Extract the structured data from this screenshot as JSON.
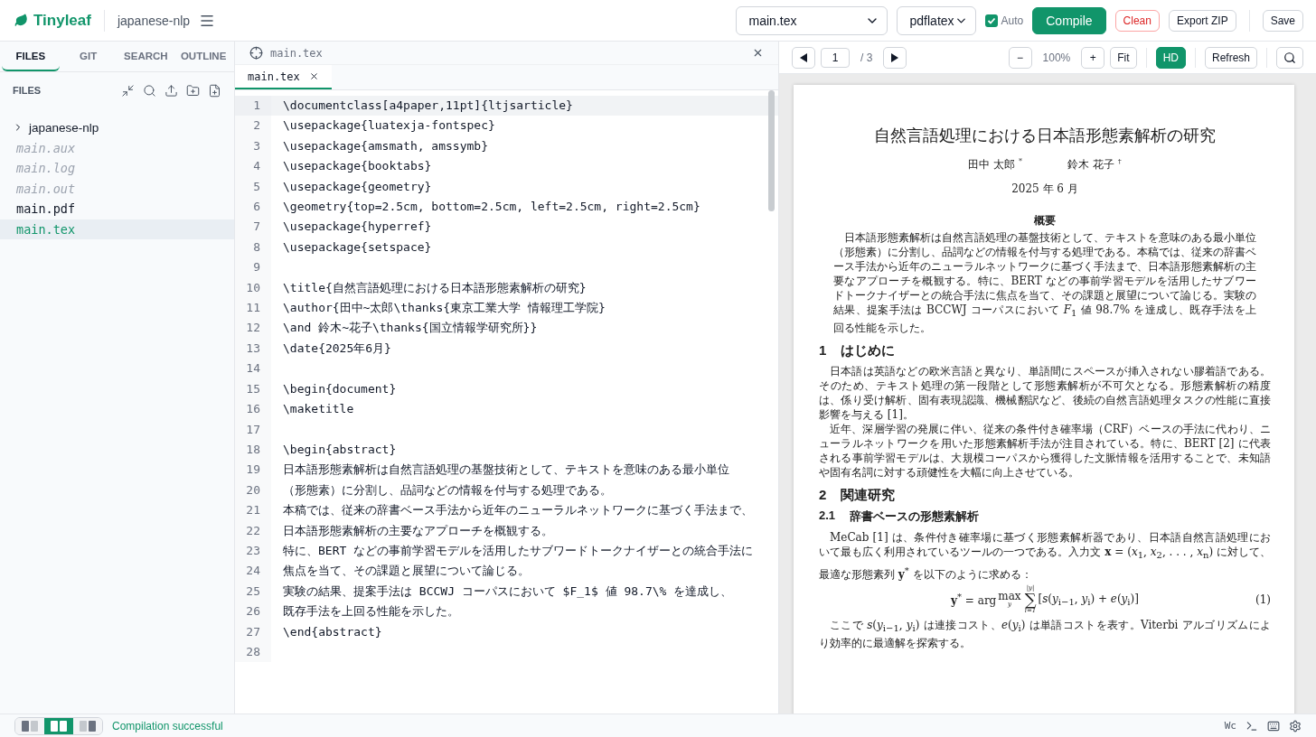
{
  "topbar": {
    "app_name": "Tinyleaf",
    "project": "japanese-nlp",
    "file_select": "main.tex",
    "engine_select": "pdflatex",
    "auto": {
      "label": "Auto",
      "checked": true
    },
    "buttons": [
      {
        "label": "Compile",
        "kind": "primary"
      },
      {
        "label": "Clean",
        "kind": "danger"
      },
      {
        "label": "Export ZIP",
        "kind": "default"
      }
    ],
    "save": "Save"
  },
  "sidebar": {
    "tabs": [
      {
        "label": "FILES",
        "selected": true
      },
      {
        "label": "GIT",
        "selected": false
      },
      {
        "label": "SEARCH",
        "selected": false
      },
      {
        "label": "OUTLINE",
        "selected": false
      }
    ],
    "header": "FILES",
    "tree": [
      {
        "kind": "folder",
        "name": "japanese-nlp",
        "expanded": false,
        "selected": false
      },
      {
        "kind": "file",
        "name": "main.aux",
        "generated": true,
        "selected": false
      },
      {
        "kind": "file",
        "name": "main.log",
        "generated": true,
        "selected": false
      },
      {
        "kind": "file",
        "name": "main.out",
        "generated": true,
        "selected": false
      },
      {
        "kind": "file",
        "name": "main.pdf",
        "generated": false,
        "selected": false
      },
      {
        "kind": "file",
        "name": "main.tex",
        "generated": false,
        "selected": true
      }
    ]
  },
  "editor": {
    "path": "main.tex",
    "tabs": [
      {
        "label": "main.tex",
        "selected": true
      }
    ],
    "lines": [
      {
        "number": "1",
        "text": "\\documentclass[a4paper,11pt]{ltjsarticle}",
        "active": true
      },
      {
        "number": "2",
        "text": "\\usepackage{luatexja-fontspec}",
        "active": false
      },
      {
        "number": "3",
        "text": "\\usepackage{amsmath, amssymb}",
        "active": false
      },
      {
        "number": "4",
        "text": "\\usepackage{booktabs}",
        "active": false
      },
      {
        "number": "5",
        "text": "\\usepackage{geometry}",
        "active": false
      },
      {
        "number": "6",
        "text": "\\geometry{top=2.5cm, bottom=2.5cm, left=2.5cm, right=2.5cm}",
        "active": false
      },
      {
        "number": "7",
        "text": "\\usepackage{hyperref}",
        "active": false
      },
      {
        "number": "8",
        "text": "\\usepackage{setspace}",
        "active": false
      },
      {
        "number": "9",
        "active": false
      },
      {
        "number": "10",
        "text": "\\title{自然言語処理における日本語形態素解析の研究}",
        "active": false
      },
      {
        "number": "11",
        "text": "\\author{田中~太郎\\thanks{東京工業大学 情報理工学院}",
        "active": false
      },
      {
        "number": "12",
        "text": "\\and 鈴木~花子\\thanks{国立情報学研究所}}",
        "active": false
      },
      {
        "number": "13",
        "text": "\\date{2025年6月}",
        "active": false
      },
      {
        "number": "14",
        "active": false
      },
      {
        "number": "15",
        "text": "\\begin{document}",
        "active": false
      },
      {
        "number": "16",
        "text": "\\maketitle",
        "active": false
      },
      {
        "number": "17",
        "active": false
      },
      {
        "number": "18",
        "text": "\\begin{abstract}",
        "active": false
      },
      {
        "number": "19",
        "text": "日本語形態素解析は自然言語処理の基盤技術として、テキストを意味のある最小単位",
        "active": false
      },
      {
        "number": "20",
        "text": "（形態素）に分割し、品詞などの情報を付与する処理である。",
        "active": false
      },
      {
        "number": "21",
        "text": "本稿では、従来の辞書ベース手法から近年のニューラルネットワークに基づく手法まで、",
        "active": false
      },
      {
        "number": "22",
        "text": "日本語形態素解析の主要なアプローチを概観する。",
        "active": false
      },
      {
        "number": "23",
        "text": "特に、BERT などの事前学習モデルを活用したサブワードトークナイザーとの統合手法に",
        "active": false
      },
      {
        "number": "24",
        "text": "焦点を当て、その課題と展望について論じる。",
        "active": false
      },
      {
        "number": "25",
        "text": "実験の結果、提案手法は BCCWJ コーパスにおいて $F_1$ 値 98.7\\% を達成し、",
        "active": false
      },
      {
        "number": "26",
        "text": "既存手法を上回る性能を示した。",
        "active": false
      },
      {
        "number": "27",
        "text": "\\end{abstract}",
        "active": false
      },
      {
        "number": "28",
        "active": false
      }
    ]
  },
  "pdf": {
    "page": "1",
    "total": "/ 3",
    "zoom_out": "−",
    "zoom": "100%",
    "zoom_in": "+",
    "fit": "Fit",
    "hd": {
      "label": "HD",
      "on": true
    },
    "refresh": "Refresh",
    "document": {
      "title": "自然言語処理における日本語形態素解析の研究",
      "authors": [
        {
          "name": "田中 太郎",
          "mark": "*"
        },
        {
          "name": "鈴木 花子",
          "mark": "†"
        }
      ],
      "date": "2025 年 6 月",
      "abstract_heading": "概要",
      "abstract": "日本語形態素解析は自然言語処理の基盤技術として、テキストを意味のある最小単位（形態素）に分割し、品詞などの情報を付与する処理である。本稿では、従来の辞書ベース手法から近年のニューラルネットワークに基づく手法まで、日本語形態素解析の主要なアプローチを概観する。特に、BERT などの事前学習モデルを活用したサブワードトークナイザーとの統合手法に焦点を当て、その課題と展望について論じる。実験の結果、提案手法は BCCWJ コーパスにおいて *F*$_{1}$ 値 98.7% を達成し、既存手法を上回る性能を示した。",
      "blocks": [
        {
          "kind": "section",
          "number": "1",
          "title": "はじめに"
        },
        {
          "kind": "paragraph",
          "text": "日本語は英語などの欧米言語と異なり、単語間にスペースが挿入されない膠着語である。そのため、テキスト処理の第一段階として形態素解析が不可欠となる。形態素解析の精度は、係り受け解析、固有表現認識、機械翻訳など、後続の自然言語処理タスクの性能に直接影響を与える [1]。"
        },
        {
          "kind": "paragraph",
          "text": "近年、深層学習の発展に伴い、従来の条件付き確率場（CRF）ベースの手法に代わり、ニューラルネットワークを用いた形態素解析手法が注目されている。特に、BERT [2] に代表される事前学習モデルは、大規模コーパスから獲得した文脈情報を活用することで、未知語や固有名詞に対する頑健性を大幅に向上させている。"
        },
        {
          "kind": "section",
          "number": "2",
          "title": "関連研究"
        },
        {
          "kind": "subsection",
          "number": "2.1",
          "title": "辞書ベースの形態素解析"
        },
        {
          "kind": "paragraph",
          "text": "MeCab [1] は、条件付き確率場に基づく形態素解析器であり、日本語自然言語処理において最も広く利用されているツールの一つである。入力文 **x** = (*x*$_{1}$, *x*$_{2}$, . . . , *x*$_{n}$) に対して、最適な形態素列 **y**$^{*}$ を以下のように求める："
        },
        {
          "kind": "equation",
          "lhs": "**y**$^{*}$ = arg ",
          "operator": "max",
          "operator_sub": "y",
          "sum_top": "|y|",
          "sum_symbol": "∑",
          "sum_bottom": "i=1",
          "body": "[*s*(*y*$_{i−1}$, *y*$_{i}$) + *e*(*y*$_{i}$)]",
          "number": "(1)"
        },
        {
          "kind": "paragraph",
          "text": "ここで *s*(*y*$_{i−1}$, *y*$_{i}$) は連接コスト、*e*(*y*$_{i}$) は単語コストを表す。Viterbi アルゴリズムにより効率的に最適解を探索する。"
        }
      ]
    }
  },
  "status": {
    "layouts": [
      {
        "kind": "editor",
        "selected": false
      },
      {
        "kind": "split",
        "selected": true
      },
      {
        "kind": "viewer",
        "selected": false
      }
    ],
    "message": "Compilation successful",
    "word_count": "Wc"
  }
}
